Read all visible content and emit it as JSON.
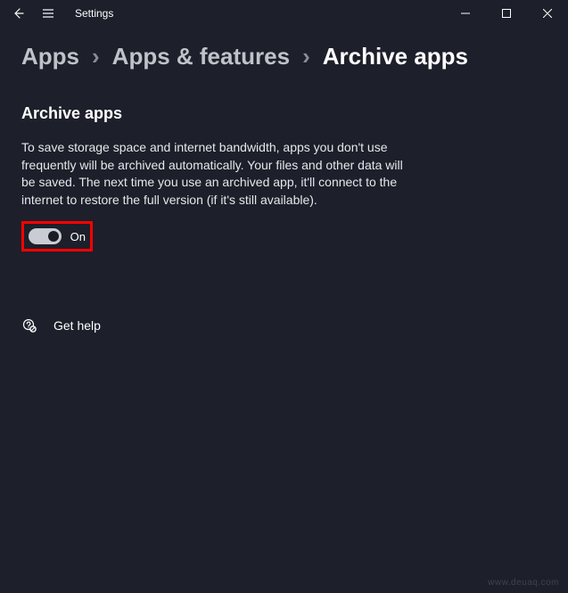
{
  "titlebar": {
    "title": "Settings"
  },
  "breadcrumb": {
    "items": [
      {
        "label": "Apps",
        "active": false
      },
      {
        "label": "Apps & features",
        "active": false
      },
      {
        "label": "Archive apps",
        "active": true
      }
    ],
    "separator": "›"
  },
  "page": {
    "heading": "Archive apps",
    "description": "To save storage space and internet bandwidth, apps you don't use frequently will be archived automatically. Your files and other data will be saved. The next time you use an archived app, it'll connect to the internet to restore the full version (if it's still available).",
    "toggle": {
      "state_label": "On",
      "on": true
    },
    "help": {
      "label": "Get help"
    }
  },
  "watermark": "www.deuaq.com"
}
